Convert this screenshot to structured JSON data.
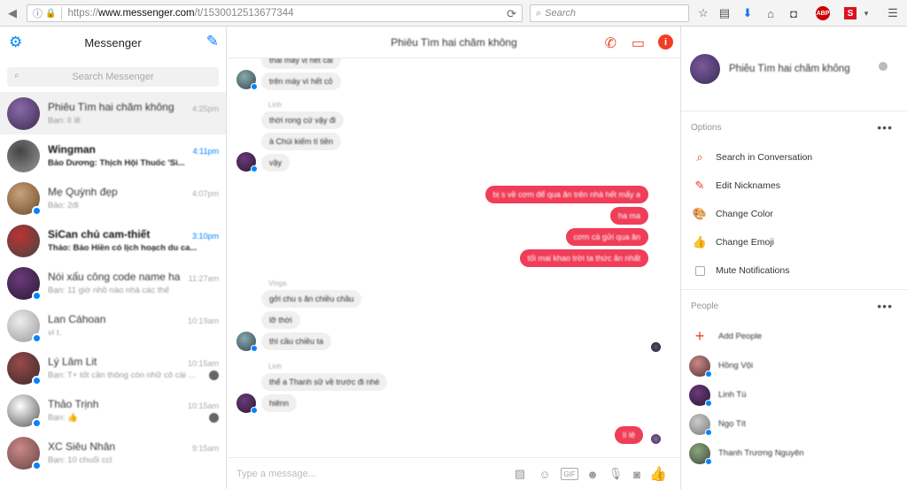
{
  "browser": {
    "url_scheme": "https://",
    "url_host": "www.messenger.com",
    "url_path": "/t/1530012513677344",
    "search_placeholder": "Search",
    "adblock": "ABP"
  },
  "sidebar": {
    "title": "Messenger",
    "search_placeholder": "Search Messenger",
    "conversations": [
      {
        "name": "Phiêu Tìm hai chăm không",
        "preview": "Bạn: lì lê",
        "time": "4:25pm",
        "unread": false,
        "active": true,
        "colors": [
          "#8a6aa8",
          "#3b2b52"
        ]
      },
      {
        "name": "Wingman",
        "preview": "Bảo Dương: Thịch Hội Thuốc 'Sì...",
        "time": "4:11pm",
        "unread": true,
        "active": false,
        "colors": [
          "#444",
          "#999"
        ]
      },
      {
        "name": "Mẹ Quỳnh đẹp",
        "preview": "Bảo: 2đi",
        "time": "4:07pm",
        "unread": false,
        "active": false,
        "colors": [
          "#c9a27a",
          "#6b4b2b"
        ]
      },
      {
        "name": "SiCan chủ cam-thiết",
        "preview": "Thảo: Bảo Hiền có lịch hoạch du ca...",
        "time": "3:10pm",
        "unread": true,
        "active": false,
        "colors": [
          "#b33",
          "#444"
        ]
      },
      {
        "name": "Nói xấu công code name ha",
        "preview": "Bạn: 11 giờ nhồ nào nhà các thế",
        "time": "11:27am",
        "unread": false,
        "active": false,
        "colors": [
          "#6b3a7a",
          "#2a1a33"
        ]
      },
      {
        "name": "Lan Cáhoan",
        "preview": "ví t.",
        "time": "10:19am",
        "unread": false,
        "active": false,
        "colors": [
          "#eee",
          "#999"
        ]
      },
      {
        "name": "Lý Lâm Lit",
        "preview": "Bạn: T+ tốt cần thông còn nhữ cô cài ...",
        "time": "10:15am",
        "unread": false,
        "active": false,
        "colors": [
          "#9a4a4a",
          "#3a2a2a"
        ]
      },
      {
        "name": "Thảo Trịnh",
        "preview": "Bạn: 👍",
        "time": "10:15am",
        "unread": false,
        "active": false,
        "colors": [
          "#fff",
          "#555"
        ]
      },
      {
        "name": "XC Siêu Nhân",
        "preview": "Bạn: 10 chuối ccl",
        "time": "9:15am",
        "unread": false,
        "active": false,
        "colors": [
          "#c88",
          "#644"
        ]
      }
    ]
  },
  "chat": {
    "title": "Phiêu Tìm hai chăm không",
    "composer_placeholder": "Type a message...",
    "incoming_group1": [
      "thai mấy vị hết cái",
      "trên mày vì hết cỏ"
    ],
    "sender2": "Linh",
    "incoming_group2": [
      "thời rong cứ vậy đi",
      "à Chúi kiếm tí tiền",
      "vậy"
    ],
    "outgoing": [
      "bị s về cơm để qua ăn trên nhà hết mấy a",
      "ha ma",
      "cơm cà gửi qua ăn",
      "tối mai khao trời ta thức ăn nhất"
    ],
    "sender3": "Vinga",
    "incoming_group3": [
      "gởi chu s ăn chiều chầu",
      "lỡ thời",
      "thì cầu chiều ta"
    ],
    "sender4": "Linh",
    "incoming_group4": [
      "thế a Thanh sữ về trước đi nhé",
      "hiênn"
    ],
    "last_outgoing": "lì lê"
  },
  "info": {
    "name": "Phiêu Tìm hai chăm không",
    "options_title": "Options",
    "options": [
      {
        "label": "Search in Conversation",
        "icon": "search-icon"
      },
      {
        "label": "Edit Nicknames",
        "icon": "pencil-icon"
      },
      {
        "label": "Change Color",
        "icon": "palette-icon"
      },
      {
        "label": "Change Emoji",
        "icon": "thumbs-up-icon"
      },
      {
        "label": "Mute Notifications",
        "icon": "checkbox-icon"
      }
    ],
    "people_title": "People",
    "add_people": "Add People",
    "people": [
      {
        "name": "Hồng Vội",
        "colors": [
          "#c88",
          "#533"
        ]
      },
      {
        "name": "Linh Tú",
        "colors": [
          "#6b3a7a",
          "#2a1a33"
        ]
      },
      {
        "name": "Ngọ Tít",
        "colors": [
          "#ccc",
          "#777"
        ]
      },
      {
        "name": "Thanh Trương Nguyên",
        "colors": [
          "#8a7",
          "#444"
        ]
      }
    ]
  },
  "colors": {
    "accent_blue": "#0084ff",
    "messenger_red": "#f03d25",
    "outgoing_bubble": "#f03d58",
    "incoming_bubble": "#f1f0f0"
  }
}
